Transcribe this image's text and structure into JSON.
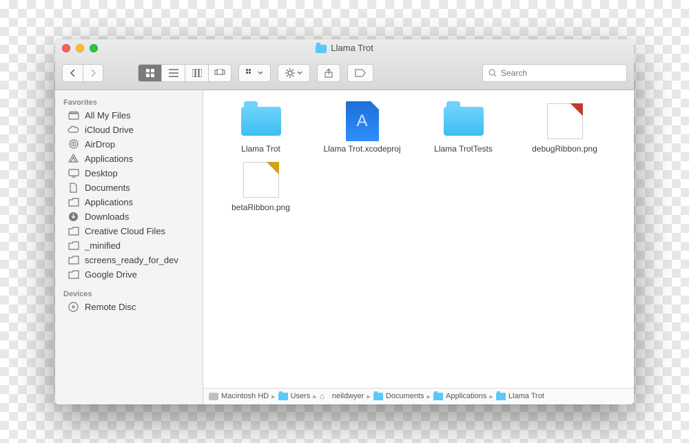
{
  "window": {
    "title": "Llama Trot"
  },
  "toolbar": {
    "search_placeholder": "Search"
  },
  "sidebar": {
    "section_favorites": "Favorites",
    "section_devices": "Devices",
    "items": [
      {
        "label": "All My Files",
        "icon": "all-my-files"
      },
      {
        "label": "iCloud Drive",
        "icon": "icloud"
      },
      {
        "label": "AirDrop",
        "icon": "airdrop"
      },
      {
        "label": "Applications",
        "icon": "applications"
      },
      {
        "label": "Desktop",
        "icon": "desktop"
      },
      {
        "label": "Documents",
        "icon": "documents"
      },
      {
        "label": "Applications",
        "icon": "folder"
      },
      {
        "label": "Downloads",
        "icon": "downloads"
      },
      {
        "label": "Creative Cloud Files",
        "icon": "folder"
      },
      {
        "label": "_minified",
        "icon": "folder"
      },
      {
        "label": "screens_ready_for_dev",
        "icon": "folder"
      },
      {
        "label": "Google Drive",
        "icon": "folder"
      }
    ],
    "devices": [
      {
        "label": "Remote Disc",
        "icon": "disc"
      }
    ]
  },
  "files": [
    {
      "name": "Llama Trot",
      "kind": "folder"
    },
    {
      "name": "Llama Trot.xcodeproj",
      "kind": "xcodeproj"
    },
    {
      "name": "Llama TrotTests",
      "kind": "folder"
    },
    {
      "name": "debugRibbon.png",
      "kind": "png-debug"
    },
    {
      "name": "betaRibbon.png",
      "kind": "png-beta"
    }
  ],
  "pathbar": [
    {
      "label": "Macintosh HD",
      "icon": "hd"
    },
    {
      "label": "Users",
      "icon": "folder"
    },
    {
      "label": "neildwyer",
      "icon": "home"
    },
    {
      "label": "Documents",
      "icon": "folder"
    },
    {
      "label": "Applications",
      "icon": "folder"
    },
    {
      "label": "Llama Trot",
      "icon": "folder"
    }
  ]
}
